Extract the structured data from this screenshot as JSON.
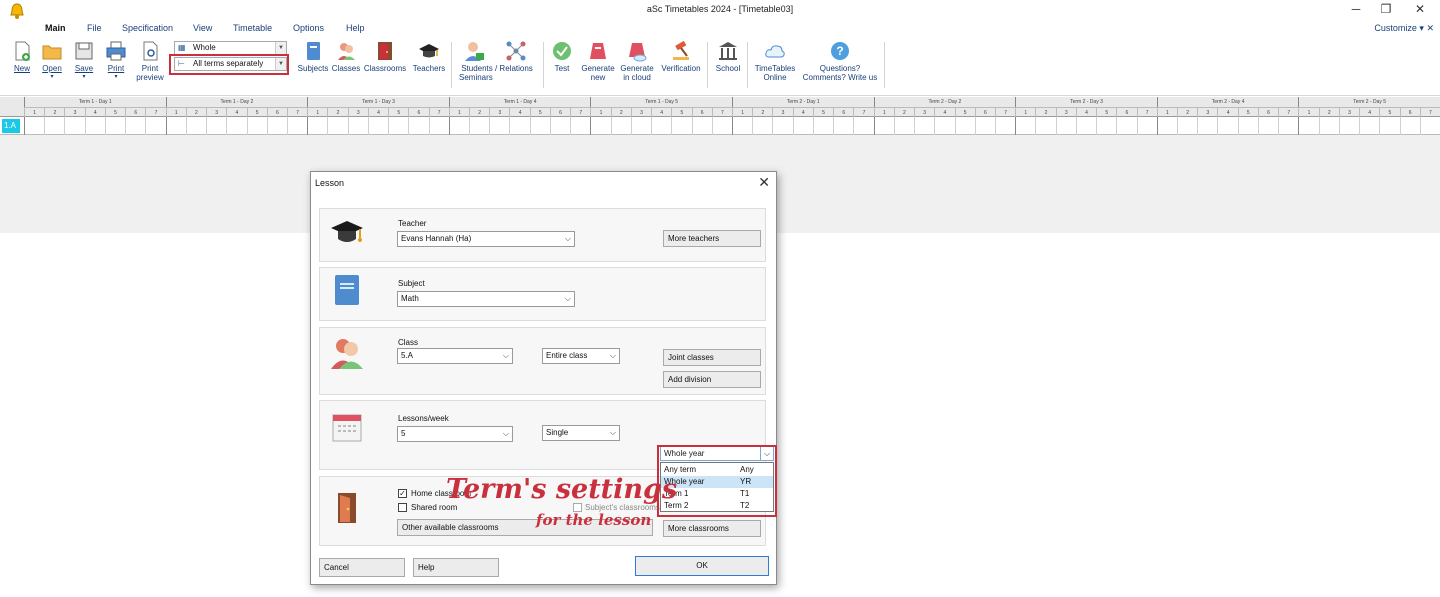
{
  "window": {
    "title": "aSc Timetables 2024  - [Timetable03]",
    "logo_icon": "bell-icon",
    "controls": {
      "minimize": "─",
      "restore": "❐",
      "close": "✕"
    }
  },
  "menu": {
    "items": [
      "Main",
      "File",
      "Specification",
      "View",
      "Timetable",
      "Options",
      "Help"
    ],
    "customize": "Customize ▾ ✕"
  },
  "ribbon": {
    "new": "New",
    "open": "Open",
    "save": "Save",
    "print": "Print",
    "print_preview_1": "Print",
    "print_preview_2": "preview",
    "view_combo": "Whole",
    "terms_combo": "All terms separately",
    "subjects": "Subjects",
    "classes": "Classes",
    "classrooms": "Classrooms",
    "teachers": "Teachers",
    "students_1": "Students / Relations",
    "students_2": "Seminars",
    "test": "Test",
    "generate_new_1": "Generate",
    "generate_new_2": "new",
    "generate_cloud_1": "Generate",
    "generate_cloud_2": "in cloud",
    "verification": "Verification",
    "school": "School",
    "online_1": "TimeTables",
    "online_2": "Online",
    "questions_1": "Questions?",
    "questions_2": "Comments? Write us"
  },
  "grid": {
    "days": [
      "Term 1 - Day 1",
      "Term 1 - Day 2",
      "Term 1 - Day 3",
      "Term 1 - Day 4",
      "Term 1 - Day 5",
      "Term 2 - Day 1",
      "Term 2 - Day 2",
      "Term 2 - Day 3",
      "Term 2 - Day 4",
      "Term 2 - Day 5"
    ],
    "periods": [
      "1",
      "2",
      "3",
      "4",
      "5",
      "6",
      "7"
    ],
    "row_label": "1.A"
  },
  "dialog": {
    "title": "Lesson",
    "teacher_label": "Teacher",
    "teacher_value": "Evans Hannah (Ha)",
    "more_teachers": "More teachers",
    "subject_label": "Subject",
    "subject_value": "Math",
    "class_label": "Class",
    "class_value": "5.A",
    "division_value": "Entire class",
    "joint_classes": "Joint classes",
    "add_division": "Add division",
    "lessons_label": "Lessons/week",
    "lessons_value": "5",
    "length_value": "Single",
    "home_classroom": "Home classroom",
    "shared_room": "Shared room",
    "subjects_classrooms": "Subject's classrooms",
    "other_classrooms": "Other available classrooms",
    "more_classrooms": "More classrooms",
    "cancel": "Cancel",
    "help": "Help",
    "ok": "OK"
  },
  "term_dropdown": {
    "selected": "Whole year",
    "options": [
      {
        "name": "Any term",
        "code": "Any"
      },
      {
        "name": "Whole year",
        "code": "YR"
      },
      {
        "name": "Term 1",
        "code": "T1"
      },
      {
        "name": "Term 2",
        "code": "T2"
      }
    ]
  },
  "annotation": {
    "main": "Term's settings",
    "sub": "for the lesson",
    "color": "#c9303e"
  }
}
